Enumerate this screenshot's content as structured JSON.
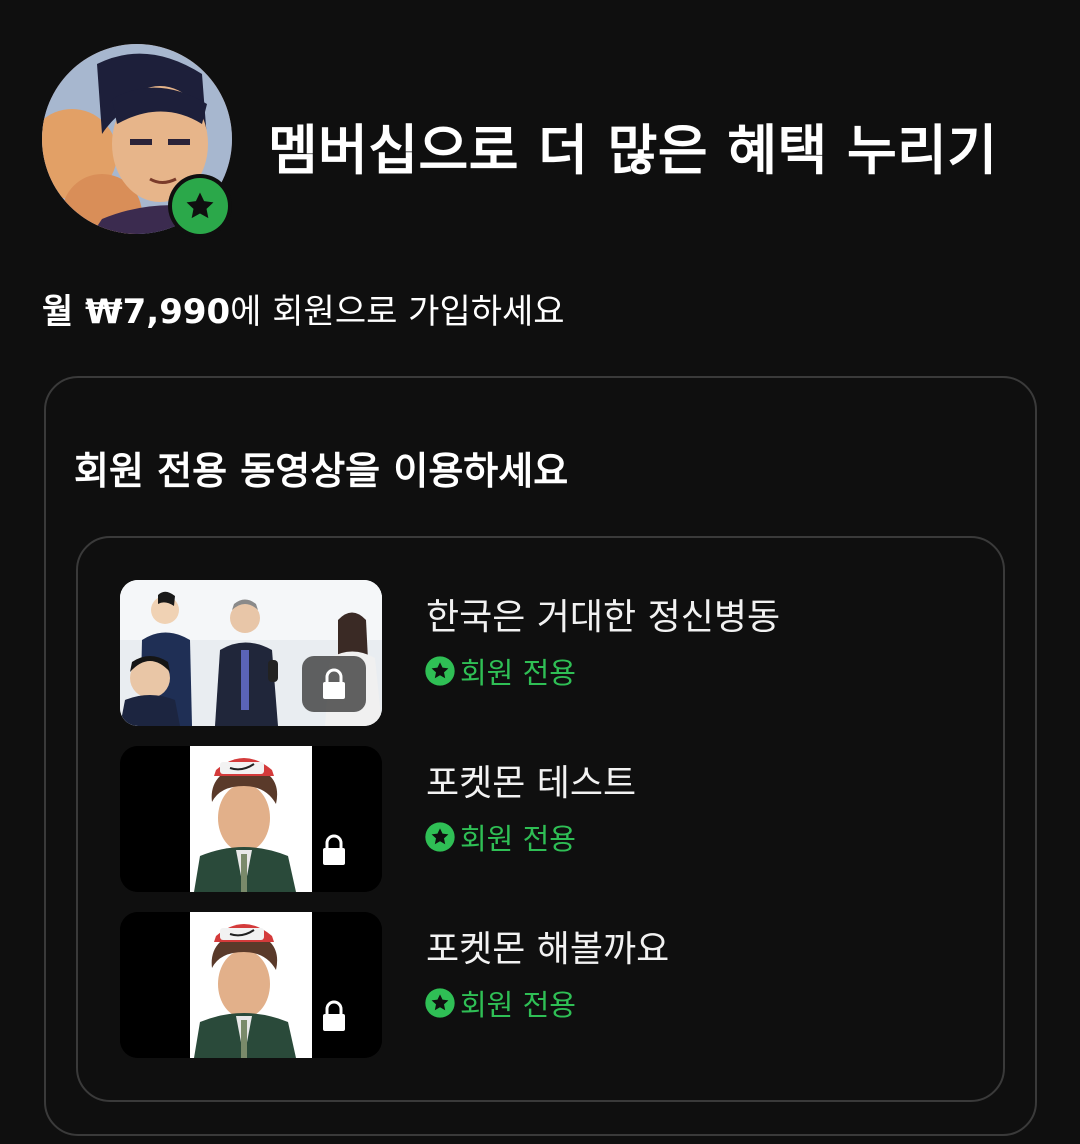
{
  "header": {
    "title": "멤버십으로 더 많은 혜택 누리기"
  },
  "offer": {
    "price_bold": "월 ₩7,990",
    "price_rest": "에 회원으로 가입하세요"
  },
  "card": {
    "title": "회원 전용 동영상을 이용하세요"
  },
  "videos": [
    {
      "title": "한국은 거대한 정신병동",
      "badge": "회원 전용"
    },
    {
      "title": "포켓몬 테스트",
      "badge": "회원 전용"
    },
    {
      "title": "포켓몬 해볼까요",
      "badge": "회원 전용"
    }
  ],
  "colors": {
    "background": "#0f0f0f",
    "accent_green": "#2fbf55",
    "border": "#3a3a3a"
  },
  "icons": {
    "avatar_badge": "star-icon",
    "lock": "lock-icon",
    "member_badge": "star-icon"
  }
}
